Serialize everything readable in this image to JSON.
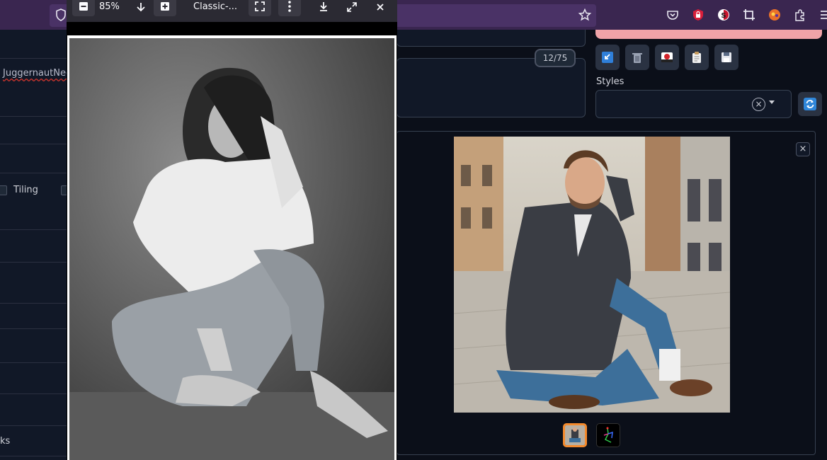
{
  "viewer": {
    "zoom": "85%",
    "title": "Classic-..."
  },
  "left_panel": {
    "negative_text": "JuggernautNeg",
    "tiling_label": "Tiling",
    "truncated_label": "ks"
  },
  "prompt": {
    "token_counter": "12/75"
  },
  "styles": {
    "label": "Styles",
    "clear_symbol": "×"
  },
  "gallery": {
    "close_symbol": "×"
  },
  "icons": [
    "shield-icon",
    "star-icon",
    "pocket-icon",
    "lock-extension-icon",
    "ublock-icon",
    "crop-icon",
    "fox-extension-icon",
    "extensions-icon",
    "menu-icon",
    "paste-prompt-icon",
    "trash-icon",
    "extra-networks-icon",
    "clipboard-icon",
    "save-style-icon",
    "refresh-icon",
    "zoom-out-icon",
    "zoom-in-icon",
    "download-arrow-icon",
    "fit-icon",
    "more-icon",
    "download-icon",
    "fullscreen-icon",
    "close-icon"
  ],
  "colors": {
    "browser_bar": "#3a2650",
    "generate_button": "#f0a3a8",
    "selected_thumb_border": "#f58a2c",
    "page_bg": "#0b0f19"
  }
}
